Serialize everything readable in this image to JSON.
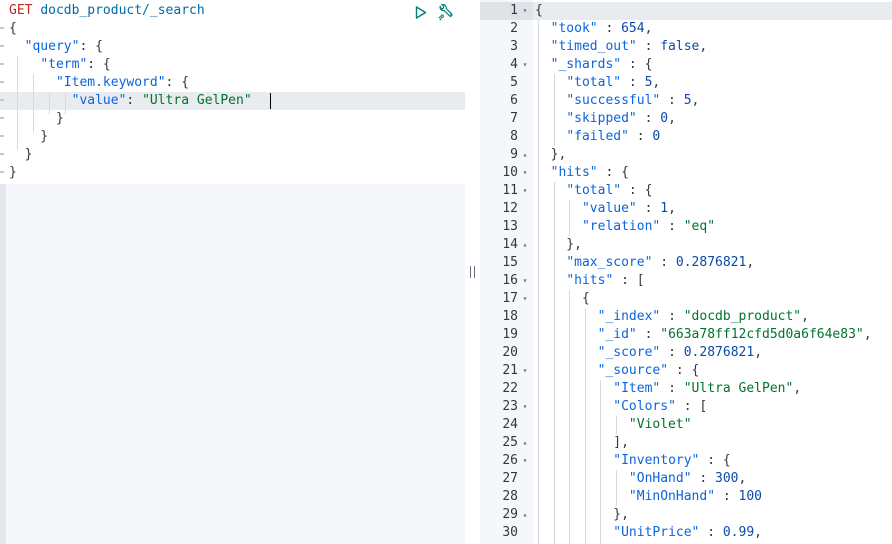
{
  "request": {
    "method": "GET",
    "path": "docdb_product/_search",
    "lines": [
      [
        {
          "t": "{",
          "c": "p"
        }
      ],
      [
        {
          "t": "  ",
          "c": "p"
        },
        {
          "t": "\"query\"",
          "c": "k"
        },
        {
          "t": ": {",
          "c": "p"
        }
      ],
      [
        {
          "t": "    ",
          "c": "p"
        },
        {
          "t": "\"term\"",
          "c": "k"
        },
        {
          "t": ": {",
          "c": "p"
        }
      ],
      [
        {
          "t": "      ",
          "c": "p"
        },
        {
          "t": "\"Item.keyword\"",
          "c": "k"
        },
        {
          "t": ": {",
          "c": "p"
        }
      ],
      [
        {
          "t": "        ",
          "c": "p"
        },
        {
          "t": "\"value\"",
          "c": "k"
        },
        {
          "t": ": ",
          "c": "p"
        },
        {
          "t": "\"Ultra GelPen\"",
          "c": "s"
        }
      ],
      [
        {
          "t": "      }",
          "c": "p"
        }
      ],
      [
        {
          "t": "    }",
          "c": "p"
        }
      ],
      [
        {
          "t": "  }",
          "c": "p"
        }
      ],
      [
        {
          "t": "}",
          "c": "p"
        }
      ]
    ]
  },
  "toolbar": {
    "run_icon": "play-triangle-icon",
    "settings_icon": "wrench-icon"
  },
  "response": {
    "lines": [
      {
        "num": "1",
        "fold": "open",
        "tokens": [
          {
            "t": "{",
            "c": "p"
          }
        ]
      },
      {
        "num": "2",
        "fold": "",
        "tokens": [
          {
            "t": "  ",
            "c": "p"
          },
          {
            "t": "\"took\"",
            "c": "k"
          },
          {
            "t": " : ",
            "c": "p"
          },
          {
            "t": "654",
            "c": "n"
          },
          {
            "t": ",",
            "c": "p"
          }
        ]
      },
      {
        "num": "3",
        "fold": "",
        "tokens": [
          {
            "t": "  ",
            "c": "p"
          },
          {
            "t": "\"timed_out\"",
            "c": "k"
          },
          {
            "t": " : ",
            "c": "p"
          },
          {
            "t": "false",
            "c": "n"
          },
          {
            "t": ",",
            "c": "p"
          }
        ]
      },
      {
        "num": "4",
        "fold": "open",
        "tokens": [
          {
            "t": "  ",
            "c": "p"
          },
          {
            "t": "\"_shards\"",
            "c": "k"
          },
          {
            "t": " : {",
            "c": "p"
          }
        ]
      },
      {
        "num": "5",
        "fold": "",
        "tokens": [
          {
            "t": "    ",
            "c": "p"
          },
          {
            "t": "\"total\"",
            "c": "k"
          },
          {
            "t": " : ",
            "c": "p"
          },
          {
            "t": "5",
            "c": "n"
          },
          {
            "t": ",",
            "c": "p"
          }
        ]
      },
      {
        "num": "6",
        "fold": "",
        "tokens": [
          {
            "t": "    ",
            "c": "p"
          },
          {
            "t": "\"successful\"",
            "c": "k"
          },
          {
            "t": " : ",
            "c": "p"
          },
          {
            "t": "5",
            "c": "n"
          },
          {
            "t": ",",
            "c": "p"
          }
        ]
      },
      {
        "num": "7",
        "fold": "",
        "tokens": [
          {
            "t": "    ",
            "c": "p"
          },
          {
            "t": "\"skipped\"",
            "c": "k"
          },
          {
            "t": " : ",
            "c": "p"
          },
          {
            "t": "0",
            "c": "n"
          },
          {
            "t": ",",
            "c": "p"
          }
        ]
      },
      {
        "num": "8",
        "fold": "",
        "tokens": [
          {
            "t": "    ",
            "c": "p"
          },
          {
            "t": "\"failed\"",
            "c": "k"
          },
          {
            "t": " : ",
            "c": "p"
          },
          {
            "t": "0",
            "c": "n"
          }
        ]
      },
      {
        "num": "9",
        "fold": "close",
        "tokens": [
          {
            "t": "  },",
            "c": "p"
          }
        ]
      },
      {
        "num": "10",
        "fold": "open",
        "tokens": [
          {
            "t": "  ",
            "c": "p"
          },
          {
            "t": "\"hits\"",
            "c": "k"
          },
          {
            "t": " : {",
            "c": "p"
          }
        ]
      },
      {
        "num": "11",
        "fold": "open",
        "tokens": [
          {
            "t": "    ",
            "c": "p"
          },
          {
            "t": "\"total\"",
            "c": "k"
          },
          {
            "t": " : {",
            "c": "p"
          }
        ]
      },
      {
        "num": "12",
        "fold": "",
        "tokens": [
          {
            "t": "      ",
            "c": "p"
          },
          {
            "t": "\"value\"",
            "c": "k"
          },
          {
            "t": " : ",
            "c": "p"
          },
          {
            "t": "1",
            "c": "n"
          },
          {
            "t": ",",
            "c": "p"
          }
        ]
      },
      {
        "num": "13",
        "fold": "",
        "tokens": [
          {
            "t": "      ",
            "c": "p"
          },
          {
            "t": "\"relation\"",
            "c": "k"
          },
          {
            "t": " : ",
            "c": "p"
          },
          {
            "t": "\"eq\"",
            "c": "s"
          }
        ]
      },
      {
        "num": "14",
        "fold": "close",
        "tokens": [
          {
            "t": "    },",
            "c": "p"
          }
        ]
      },
      {
        "num": "15",
        "fold": "",
        "tokens": [
          {
            "t": "    ",
            "c": "p"
          },
          {
            "t": "\"max_score\"",
            "c": "k"
          },
          {
            "t": " : ",
            "c": "p"
          },
          {
            "t": "0.2876821",
            "c": "n"
          },
          {
            "t": ",",
            "c": "p"
          }
        ]
      },
      {
        "num": "16",
        "fold": "open",
        "tokens": [
          {
            "t": "    ",
            "c": "p"
          },
          {
            "t": "\"hits\"",
            "c": "k"
          },
          {
            "t": " : [",
            "c": "p"
          }
        ]
      },
      {
        "num": "17",
        "fold": "open",
        "tokens": [
          {
            "t": "      {",
            "c": "p"
          }
        ]
      },
      {
        "num": "18",
        "fold": "",
        "tokens": [
          {
            "t": "        ",
            "c": "p"
          },
          {
            "t": "\"_index\"",
            "c": "k"
          },
          {
            "t": " : ",
            "c": "p"
          },
          {
            "t": "\"docdb_product\"",
            "c": "s"
          },
          {
            "t": ",",
            "c": "p"
          }
        ]
      },
      {
        "num": "19",
        "fold": "",
        "tokens": [
          {
            "t": "        ",
            "c": "p"
          },
          {
            "t": "\"_id\"",
            "c": "k"
          },
          {
            "t": " : ",
            "c": "p"
          },
          {
            "t": "\"663a78ff12cfd5d0a6f64e83\"",
            "c": "s"
          },
          {
            "t": ",",
            "c": "p"
          }
        ]
      },
      {
        "num": "20",
        "fold": "",
        "tokens": [
          {
            "t": "        ",
            "c": "p"
          },
          {
            "t": "\"_score\"",
            "c": "k"
          },
          {
            "t": " : ",
            "c": "p"
          },
          {
            "t": "0.2876821",
            "c": "n"
          },
          {
            "t": ",",
            "c": "p"
          }
        ]
      },
      {
        "num": "21",
        "fold": "open",
        "tokens": [
          {
            "t": "        ",
            "c": "p"
          },
          {
            "t": "\"_source\"",
            "c": "k"
          },
          {
            "t": " : {",
            "c": "p"
          }
        ]
      },
      {
        "num": "22",
        "fold": "",
        "tokens": [
          {
            "t": "          ",
            "c": "p"
          },
          {
            "t": "\"Item\"",
            "c": "k"
          },
          {
            "t": " : ",
            "c": "p"
          },
          {
            "t": "\"Ultra GelPen\"",
            "c": "s"
          },
          {
            "t": ",",
            "c": "p"
          }
        ]
      },
      {
        "num": "23",
        "fold": "open",
        "tokens": [
          {
            "t": "          ",
            "c": "p"
          },
          {
            "t": "\"Colors\"",
            "c": "k"
          },
          {
            "t": " : [",
            "c": "p"
          }
        ]
      },
      {
        "num": "24",
        "fold": "",
        "tokens": [
          {
            "t": "            ",
            "c": "p"
          },
          {
            "t": "\"Violet\"",
            "c": "s"
          }
        ]
      },
      {
        "num": "25",
        "fold": "close",
        "tokens": [
          {
            "t": "          ],",
            "c": "p"
          }
        ]
      },
      {
        "num": "26",
        "fold": "open",
        "tokens": [
          {
            "t": "          ",
            "c": "p"
          },
          {
            "t": "\"Inventory\"",
            "c": "k"
          },
          {
            "t": " : {",
            "c": "p"
          }
        ]
      },
      {
        "num": "27",
        "fold": "",
        "tokens": [
          {
            "t": "            ",
            "c": "p"
          },
          {
            "t": "\"OnHand\"",
            "c": "k"
          },
          {
            "t": " : ",
            "c": "p"
          },
          {
            "t": "300",
            "c": "n"
          },
          {
            "t": ",",
            "c": "p"
          }
        ]
      },
      {
        "num": "28",
        "fold": "",
        "tokens": [
          {
            "t": "            ",
            "c": "p"
          },
          {
            "t": "\"MinOnHand\"",
            "c": "k"
          },
          {
            "t": " : ",
            "c": "p"
          },
          {
            "t": "100",
            "c": "n"
          }
        ]
      },
      {
        "num": "29",
        "fold": "close",
        "tokens": [
          {
            "t": "          },",
            "c": "p"
          }
        ]
      },
      {
        "num": "30",
        "fold": "",
        "tokens": [
          {
            "t": "          ",
            "c": "p"
          },
          {
            "t": "\"UnitPrice\"",
            "c": "k"
          },
          {
            "t": " : ",
            "c": "p"
          },
          {
            "t": "0.99",
            "c": "n"
          },
          {
            "t": ",",
            "c": "p"
          }
        ]
      }
    ]
  },
  "colors": {
    "method": "#bd271e",
    "path": "#006ba8",
    "key": "#0b64dd",
    "string": "#00742c",
    "number": "#0b4aa8",
    "action_icon": "#017d73"
  }
}
